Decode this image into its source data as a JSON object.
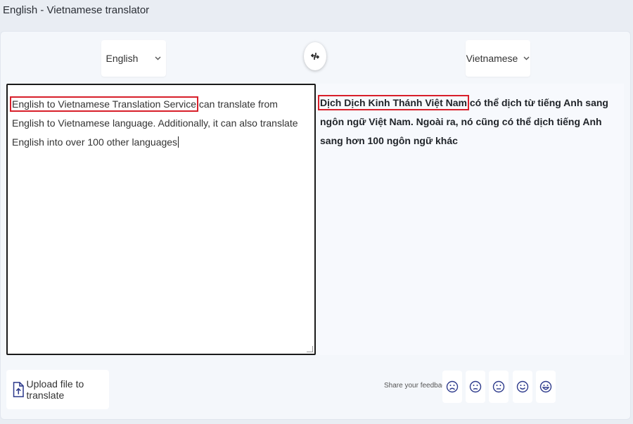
{
  "window": {
    "title": "English - Vietnamese translator"
  },
  "languages": {
    "source": "English",
    "target": "Vietnamese"
  },
  "source": {
    "highlighted": "English to Vietnamese Translation Service",
    "rest": " can translate from English to Vietnamese language. Additionally, it can also translate English into over 100 other languages"
  },
  "target": {
    "highlighted": "Dịch Dịch Kinh Thánh Việt Nam",
    "rest": " có thể dịch từ tiếng Anh sang ngôn ngữ Việt Nam. Ngoài ra, nó cũng có thể dịch tiếng Anh sang hơn 100 ngôn ngữ khác"
  },
  "footer": {
    "upload_label": "Upload file to translate",
    "feedback_label": "Share your feedback:"
  },
  "icons": {
    "swap": "swap-arrows-icon",
    "upload": "file-upload-icon",
    "feedback": [
      "very-sad-face-icon",
      "sad-face-icon",
      "neutral-face-icon",
      "happy-face-icon",
      "very-happy-face-icon"
    ]
  },
  "colors": {
    "highlight": "#d81f2a"
  }
}
